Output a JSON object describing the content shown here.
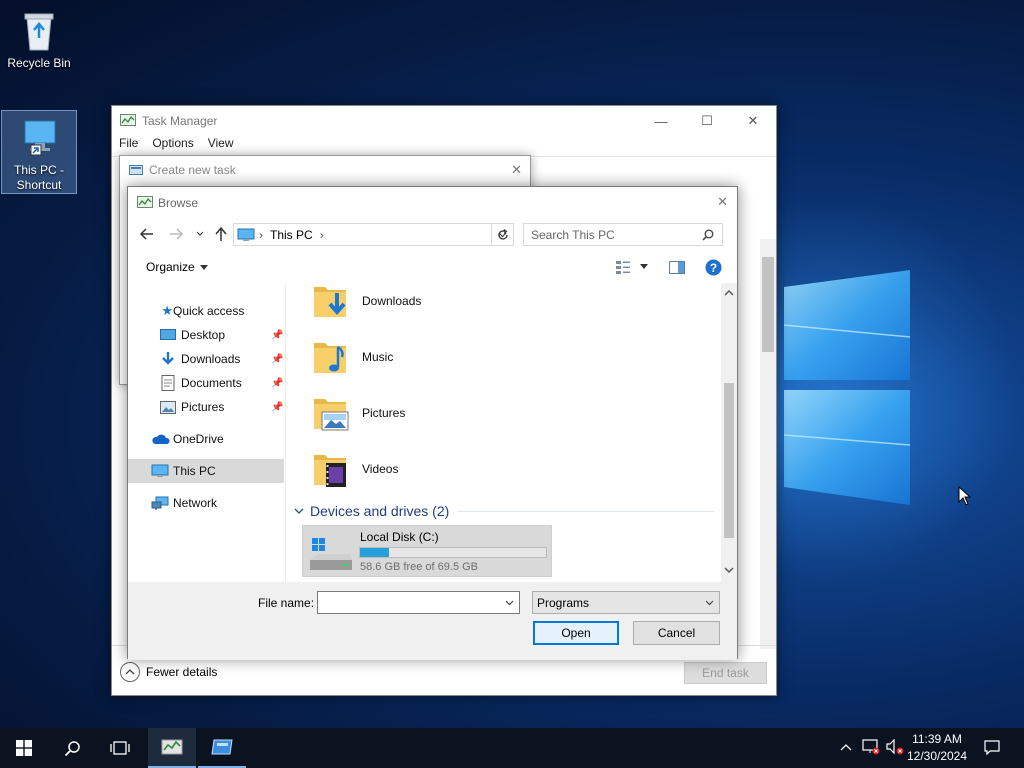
{
  "desktop": {
    "icons": [
      {
        "label": "Recycle Bin"
      },
      {
        "label": "This PC -\nShortcut",
        "line1": "This PC -",
        "line2": "Shortcut"
      }
    ]
  },
  "task_manager": {
    "title": "Task Manager",
    "menu": [
      "File",
      "Options",
      "View"
    ],
    "fewer_details": "Fewer details",
    "end_task": "End task"
  },
  "create_task": {
    "title": "Create new task"
  },
  "browse": {
    "title": "Browse",
    "address": {
      "location": "This PC"
    },
    "search": {
      "placeholder": "Search This PC"
    },
    "toolbar": {
      "organize": "Organize"
    },
    "nav": [
      {
        "label": "Quick access"
      },
      {
        "label": "Desktop"
      },
      {
        "label": "Downloads"
      },
      {
        "label": "Documents"
      },
      {
        "label": "Pictures"
      },
      {
        "label": "OneDrive"
      },
      {
        "label": "This PC"
      },
      {
        "label": "Network"
      }
    ],
    "folders": [
      {
        "label": "Downloads"
      },
      {
        "label": "Music"
      },
      {
        "label": "Pictures"
      },
      {
        "label": "Videos"
      }
    ],
    "devices_header": "Devices and drives (2)",
    "drive": {
      "name": "Local Disk (C:)",
      "free": "58.6 GB free of 69.5 GB",
      "used_fraction": 0.157
    },
    "footer": {
      "file_name_label": "File name:",
      "file_name_value": "",
      "file_type": "Programs",
      "open": "Open",
      "cancel": "Cancel"
    }
  },
  "taskbar": {
    "time": "11:39 AM",
    "date": "12/30/2024"
  },
  "colors": {
    "accent": "#0078d7",
    "taskbar": "#0b1220",
    "folder": "#f3c75f",
    "selection": "#d9d9d9"
  }
}
